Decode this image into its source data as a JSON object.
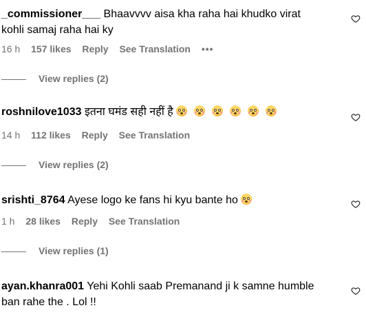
{
  "comments": [
    {
      "username": "_commissioner___",
      "text_line1": "Bhaavvvv aisa kha raha hai khudko virat",
      "text_line2": "kohli samaj raha hai ky",
      "time": "16 h",
      "likes": "157 likes",
      "reply": "Reply",
      "translate": "See Translation",
      "more": "•••",
      "view_replies": "View replies (2)"
    },
    {
      "username": "roshnilove1033",
      "text_line1": "इतना घमंड सही नहीं है",
      "emoji_count": 6,
      "time": "14 h",
      "likes": "112 likes",
      "reply": "Reply",
      "translate": "See Translation",
      "view_replies": "View replies (2)"
    },
    {
      "username": "srishti_8764",
      "text_line1": "Ayese logo ke fans hi kyu bante ho",
      "emoji_count": 1,
      "time": "1 h",
      "likes": "28 likes",
      "reply": "Reply",
      "translate": "See Translation",
      "view_replies": "View replies (1)"
    },
    {
      "username": "ayan.khanra001",
      "text_line1": "Yehi Kohli saab Premanand ji k samne humble",
      "text_line2": "ban rahe the . Lol !!"
    }
  ],
  "icons": {
    "like": "heart-outline-icon",
    "emoji": "flushed-face-emoji"
  }
}
